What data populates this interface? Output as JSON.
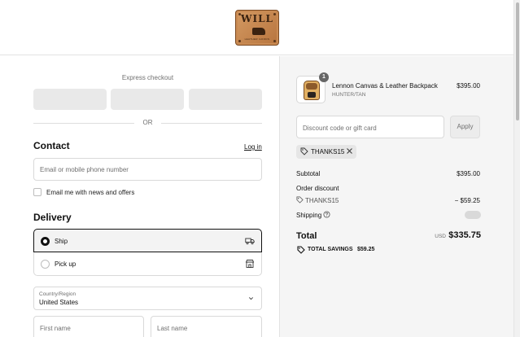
{
  "header": {
    "logo": {
      "brand": "WILL",
      "subtitle": "LEATHER GOODS"
    }
  },
  "express": {
    "label": "Express checkout",
    "buttons": [
      "",
      "",
      ""
    ],
    "divider": "OR"
  },
  "contact": {
    "title": "Contact",
    "login_link": "Log in",
    "email_placeholder": "Email or mobile phone number",
    "newsletter_label": "Email me with news and offers",
    "newsletter_checked": false
  },
  "delivery": {
    "title": "Delivery",
    "options": [
      {
        "label": "Ship",
        "selected": true,
        "icon": "truck-icon"
      },
      {
        "label": "Pick up",
        "selected": false,
        "icon": "store-icon"
      }
    ],
    "country": {
      "label": "Country/Region",
      "value": "United States"
    },
    "first_name_placeholder": "First name",
    "last_name_placeholder": "Last name"
  },
  "summary": {
    "item": {
      "name": "Lennon Canvas & Leather Backpack",
      "variant": "HUNTER/TAN",
      "price": "$395.00",
      "quantity": "1"
    },
    "discount_placeholder": "Discount code or gift card",
    "apply_label": "Apply",
    "applied_code": "THANKS15",
    "subtotal_label": "Subtotal",
    "subtotal_value": "$395.00",
    "order_discount_label": "Order discount",
    "discount_code": "THANKS15",
    "discount_value": "− $59.25",
    "shipping_label": "Shipping",
    "total_label": "Total",
    "currency": "USD",
    "total_value": "$335.75",
    "savings_label": "TOTAL SAVINGS",
    "savings_value": "$59.25"
  },
  "colors": {
    "accent": "#111111",
    "muted": "#707070",
    "panel": "#f5f5f5",
    "logo": "#c98a52"
  }
}
